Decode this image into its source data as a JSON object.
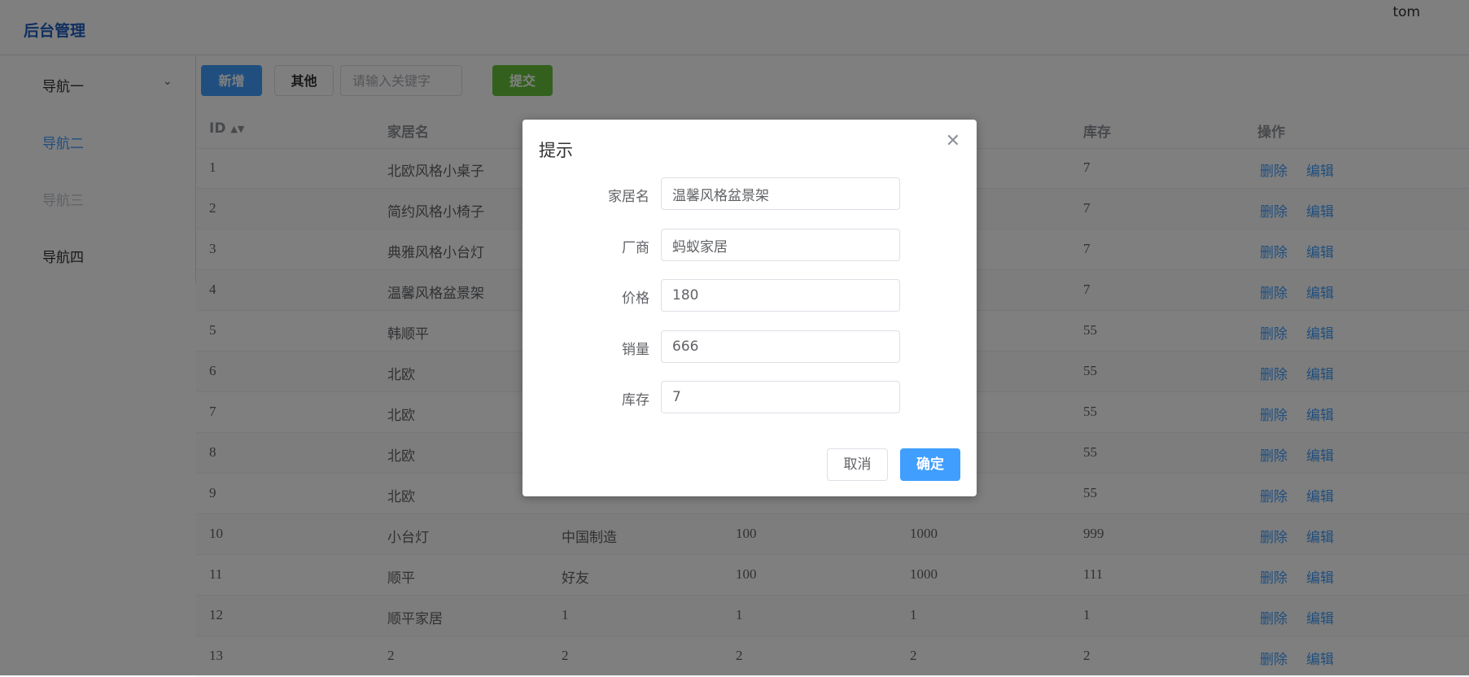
{
  "header": {
    "logo": "后台管理",
    "user": "tom"
  },
  "sidebar": {
    "items": [
      {
        "label": "导航一"
      },
      {
        "label": "导航二"
      },
      {
        "label": "导航三"
      },
      {
        "label": "导航四"
      }
    ]
  },
  "toolbar": {
    "add_label": "新增",
    "other_label": "其他",
    "search_placeholder": "请输入关键字",
    "submit_label": "提交"
  },
  "table": {
    "headers": [
      "ID",
      "家居名",
      "",
      "",
      "",
      "库存",
      "操作"
    ],
    "delete_label": "删除",
    "edit_label": "编辑",
    "rows": [
      {
        "id": "1",
        "name": "北欧风格小桌子",
        "maker": "",
        "price": "",
        "sales": "",
        "stock": "7"
      },
      {
        "id": "2",
        "name": "简约风格小椅子",
        "maker": "",
        "price": "",
        "sales": "",
        "stock": "7"
      },
      {
        "id": "3",
        "name": "典雅风格小台灯",
        "maker": "",
        "price": "",
        "sales": "",
        "stock": "7"
      },
      {
        "id": "4",
        "name": "温馨风格盆景架",
        "maker": "",
        "price": "",
        "sales": "",
        "stock": "7"
      },
      {
        "id": "5",
        "name": "韩顺平",
        "maker": "",
        "price": "",
        "sales": "",
        "stock": "55"
      },
      {
        "id": "6",
        "name": "北欧",
        "maker": "",
        "price": "",
        "sales": "",
        "stock": "55"
      },
      {
        "id": "7",
        "name": "北欧",
        "maker": "",
        "price": "",
        "sales": "",
        "stock": "55"
      },
      {
        "id": "8",
        "name": "北欧",
        "maker": "",
        "price": "",
        "sales": "",
        "stock": "55"
      },
      {
        "id": "9",
        "name": "北欧",
        "maker": "",
        "price": "",
        "sales": "",
        "stock": "55"
      },
      {
        "id": "10",
        "name": "小台灯",
        "maker": "中国制造",
        "price": "100",
        "sales": "1000",
        "stock": "999"
      },
      {
        "id": "11",
        "name": "顺平",
        "maker": "好友",
        "price": "100",
        "sales": "1000",
        "stock": "111"
      },
      {
        "id": "12",
        "name": "顺平家居",
        "maker": "1",
        "price": "1",
        "sales": "1",
        "stock": "1"
      },
      {
        "id": "13",
        "name": "2",
        "maker": "2",
        "price": "2",
        "sales": "2",
        "stock": "2"
      }
    ]
  },
  "dialog": {
    "title": "提示",
    "fields": [
      {
        "label": "家居名",
        "value": "温馨风格盆景架"
      },
      {
        "label": "厂商",
        "value": "蚂蚁家居"
      },
      {
        "label": "价格",
        "value": "180"
      },
      {
        "label": "销量",
        "value": "666"
      },
      {
        "label": "库存",
        "value": "7"
      }
    ],
    "cancel_label": "取消",
    "ok_label": "确定"
  },
  "colors": {
    "primary": "#409eff",
    "success": "#67c23a",
    "overlay": "rgba(0,0,0,0.5)"
  }
}
